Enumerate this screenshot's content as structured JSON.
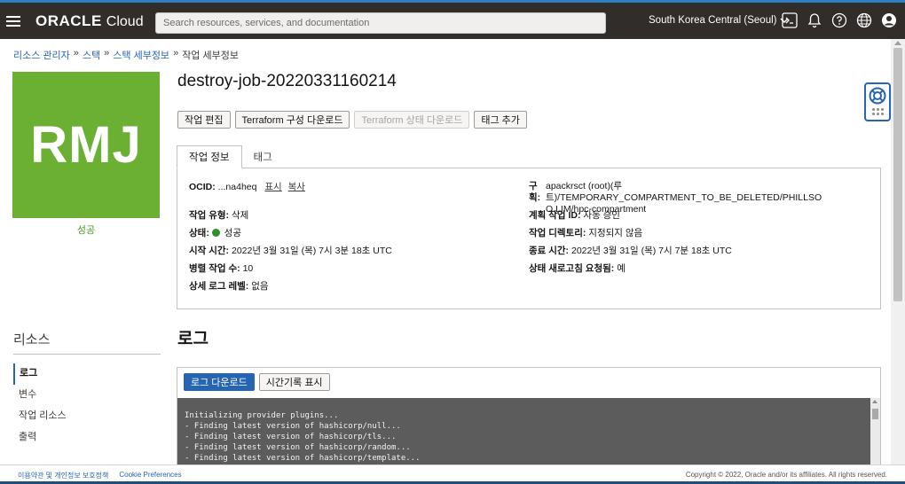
{
  "topbar": {
    "brand_oracle": "ORACLE",
    "brand_cloud": "Cloud",
    "search_placeholder": "Search resources, services, and documentation",
    "region": "South Korea Central (Seoul)"
  },
  "breadcrumb": {
    "items": [
      "리소스 관리자",
      "스택",
      "스택 세부정보",
      "작업 세부정보"
    ],
    "separator": "»"
  },
  "job": {
    "logo_text": "RMJ",
    "logo_color": "#6bb032",
    "status_caption": "성공",
    "title": "destroy-job-20220331160214"
  },
  "actions": {
    "edit": "작업 편집",
    "download_config": "Terraform 구성 다운로드",
    "download_state": "Terraform 상태 다운로드",
    "add_tag": "태그 추가"
  },
  "tabs": {
    "job_info": "작업 정보",
    "tags": "태그"
  },
  "details": {
    "ocid_label": "OCID:",
    "ocid_value": "...na4heq",
    "ocid_show": "표시",
    "ocid_copy": "복사",
    "job_type_label": "작업 유형:",
    "job_type_value": "삭제",
    "state_label": "상태:",
    "state_value": "성공",
    "start_label": "시작 시간:",
    "start_value": "2022년 3월 31일 (목) 7시 3분 18초 UTC",
    "parallel_label": "병렬 작업 수:",
    "parallel_value": "10",
    "log_level_label": "상세 로그 레벨:",
    "log_level_value": "없음",
    "compartment_label": "구획:",
    "compartment_value": "apackrsct (root)(루트)/TEMPORARY_COMPARTMENT_TO_BE_DELETED/PHILLSO O.LIM/hpc-compartment",
    "plan_job_label": "계획 작업 ID:",
    "plan_job_value": "자동 승인",
    "directory_label": "작업 디렉토리:",
    "directory_value": "지정되지 않음",
    "end_label": "종료 시간:",
    "end_value": "2022년 3월 31일 (목) 7시 7분 18초 UTC",
    "refresh_label": "상태 새로고침 요청됨:",
    "refresh_value": "예"
  },
  "resources": {
    "title": "리소스",
    "items": [
      "로그",
      "변수",
      "작업 리소스",
      "출력"
    ]
  },
  "logs": {
    "title": "로그",
    "download": "로그 다운로드",
    "show_timestamps": "시간기록 표시",
    "lines": [
      "Initializing provider plugins...",
      "- Finding latest version of hashicorp/null...",
      "- Finding latest version of hashicorp/tls...",
      "- Finding latest version of hashicorp/random...",
      "- Finding latest version of hashicorp/template..."
    ]
  },
  "footer": {
    "terms": "이용약관 및 개인정보 보호정책",
    "cookies": "Cookie Preferences",
    "copyright": "Copyright © 2022, Oracle and/or its affiliates. All rights reserved."
  },
  "colors": {
    "topbar": "#312d2a",
    "accent": "#2565b3",
    "success": "#2f8f28"
  }
}
